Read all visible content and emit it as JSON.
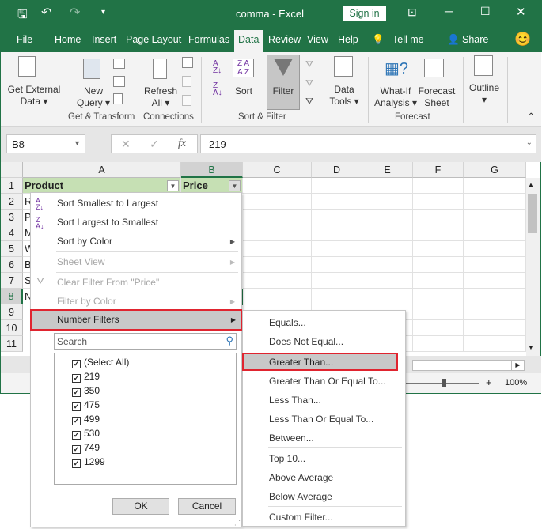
{
  "titlebar": {
    "title": "comma  -  Excel",
    "sign_in": "Sign in"
  },
  "tabs": [
    "File",
    "Home",
    "Insert",
    "Page Layout",
    "Formulas",
    "Data",
    "Review",
    "View",
    "Help",
    "Tell me",
    "Share"
  ],
  "ribbon": {
    "get_external_1": "Get External",
    "get_external_2": "Data",
    "new_query_1": "New",
    "new_query_2": "Query",
    "refresh_1": "Refresh",
    "refresh_2": "All",
    "sort": "Sort",
    "filter": "Filter",
    "data_tools_1": "Data",
    "data_tools_2": "Tools",
    "whatif_1": "What-If",
    "whatif_2": "Analysis",
    "forecast_1": "Forecast",
    "forecast_2": "Sheet",
    "outline": "Outline",
    "groups": [
      "Get & Transform",
      "Connections",
      "Sort & Filter",
      "Forecast"
    ]
  },
  "formula_bar": {
    "name_box": "B8",
    "fx": "fx",
    "value": "219"
  },
  "columns": [
    "A",
    "B",
    "C",
    "D",
    "E",
    "F",
    "G"
  ],
  "rows": [
    "1",
    "2",
    "3",
    "4",
    "5",
    "6",
    "7",
    "8",
    "9",
    "10",
    "11"
  ],
  "cells": {
    "A1": "Product",
    "B1": "Price",
    "A": [
      "R",
      "P",
      "M",
      "W",
      "B",
      "S",
      "N"
    ]
  },
  "filter_menu": {
    "items": [
      "Sort Smallest to Largest",
      "Sort Largest to Smallest",
      "Sort by Color",
      "Sheet View",
      "Clear Filter From \"Price\"",
      "Filter by Color",
      "Number Filters"
    ],
    "search_placeholder": "Search",
    "checklist": [
      "(Select All)",
      "219",
      "350",
      "475",
      "499",
      "530",
      "749",
      "1299"
    ],
    "ok": "OK",
    "cancel": "Cancel"
  },
  "number_filters": [
    "Equals...",
    "Does Not Equal...",
    "Greater Than...",
    "Greater Than Or Equal To...",
    "Less Than...",
    "Less Than Or Equal To...",
    "Between...",
    "Top 10...",
    "Above Average",
    "Below Average",
    "Custom Filter..."
  ],
  "status": {
    "zoom": "100%",
    "zoom_level": 100
  },
  "colors": {
    "accent": "#217346",
    "header_fill": "#c6e0b4",
    "highlight_border": "#e0242f"
  }
}
